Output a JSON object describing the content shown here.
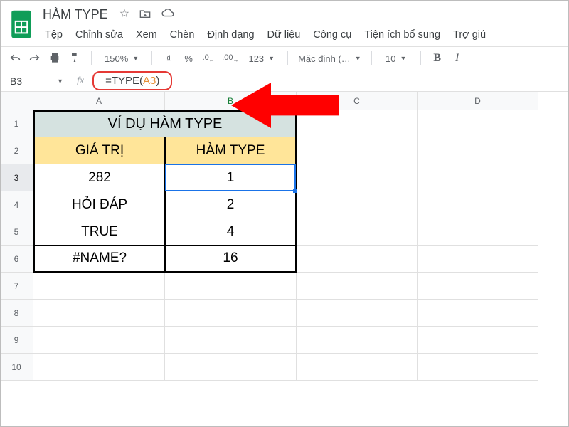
{
  "doc": {
    "title": "HÀM TYPE"
  },
  "menus": {
    "file": "Tệp",
    "edit": "Chỉnh sửa",
    "view": "Xem",
    "insert": "Chèn",
    "format": "Định dạng",
    "data": "Dữ liệu",
    "tools": "Công cụ",
    "addons": "Tiện ích bổ sung",
    "help": "Trợ giú"
  },
  "toolbar": {
    "zoom": "150%",
    "currency": "₫",
    "percent": "%",
    "dec_less": ".0←",
    "dec_more": ".00→",
    "numfmt": "123",
    "font": "Mặc định (…",
    "font_size": "10",
    "bold": "B",
    "italic": "I"
  },
  "formula": {
    "name_box": "B3",
    "prefix": "=TYPE(",
    "ref": "A3",
    "suffix": ")"
  },
  "columns": [
    "A",
    "B",
    "C",
    "D"
  ],
  "rows": [
    "1",
    "2",
    "3",
    "4",
    "5",
    "6",
    "7",
    "8",
    "9",
    "10"
  ],
  "table": {
    "title": "VÍ DỤ HÀM TYPE",
    "head_a": "GIÁ TRỊ",
    "head_b": "HÀM TYPE",
    "r3a": "282",
    "r3b": "1",
    "r4a": "HỎI ĐÁP",
    "r4b": "2",
    "r5a": "TRUE",
    "r5b": "4",
    "r6a": "#NAME?",
    "r6b": "16"
  }
}
